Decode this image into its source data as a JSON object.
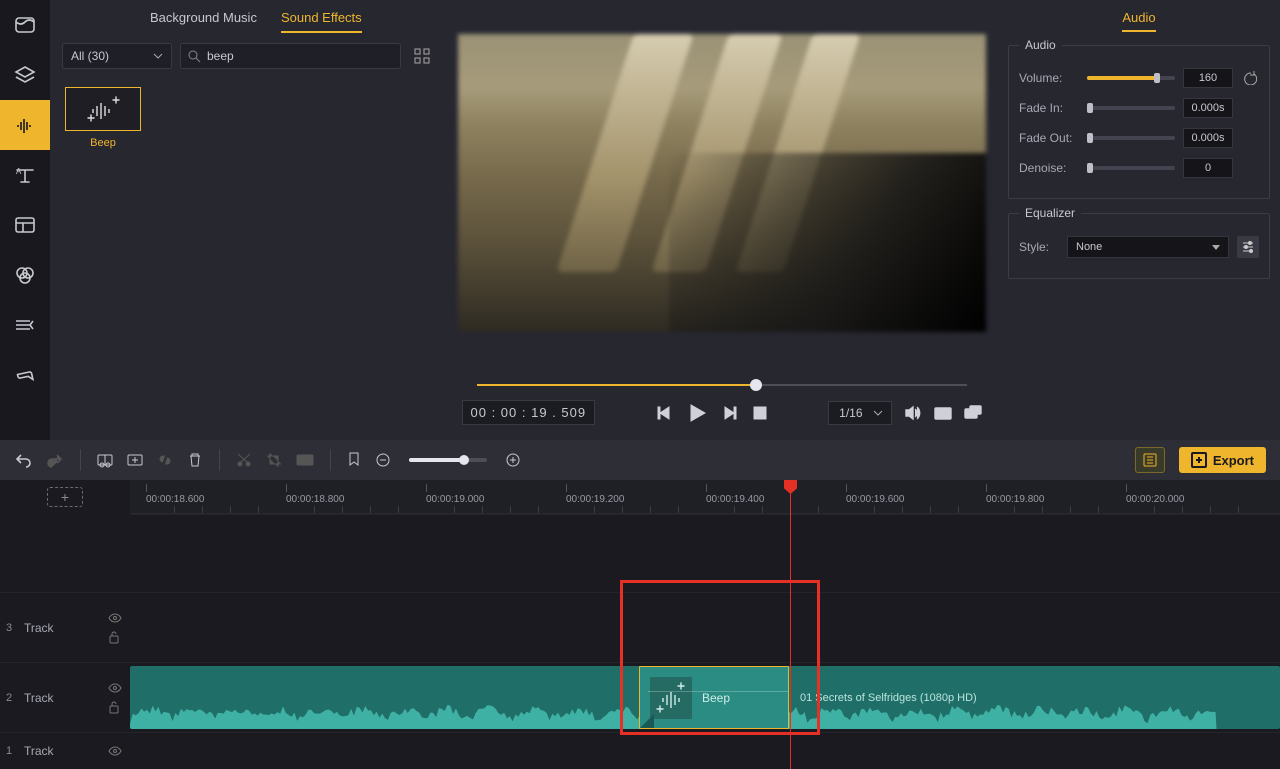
{
  "library": {
    "tabs": {
      "bg": "Background Music",
      "sfx": "Sound Effects"
    },
    "filter": "All (30)",
    "search_value": "beep",
    "items": [
      {
        "label": "Beep"
      }
    ]
  },
  "player": {
    "time": "00 : 00 : 19 . 509",
    "zoom": "1/16"
  },
  "props": {
    "tab": "Audio",
    "group_audio": "Audio",
    "group_eq": "Equalizer",
    "volume": {
      "label": "Volume:",
      "value": "160"
    },
    "fade_in": {
      "label": "Fade In:",
      "value": "0.000s"
    },
    "fade_out": {
      "label": "Fade Out:",
      "value": "0.000s"
    },
    "denoise": {
      "label": "Denoise:",
      "value": "0"
    },
    "eq_style_label": "Style:",
    "eq_style_value": "None"
  },
  "toolbar": {
    "export": "Export"
  },
  "timeline": {
    "ruler": [
      "00:00:18.600",
      "00:00:18.800",
      "00:00:19.000",
      "00:00:19.200",
      "00:00:19.400",
      "00:00:19.600",
      "00:00:19.800",
      "00:00:20.000"
    ],
    "tracks": [
      {
        "idx": "3",
        "name": "Track"
      },
      {
        "idx": "2",
        "name": "Track"
      },
      {
        "idx": "1",
        "name": "Track"
      }
    ],
    "main_clip_label": "01 Secrets of Selfridges (1080p HD)",
    "beep_label": "Beep"
  }
}
